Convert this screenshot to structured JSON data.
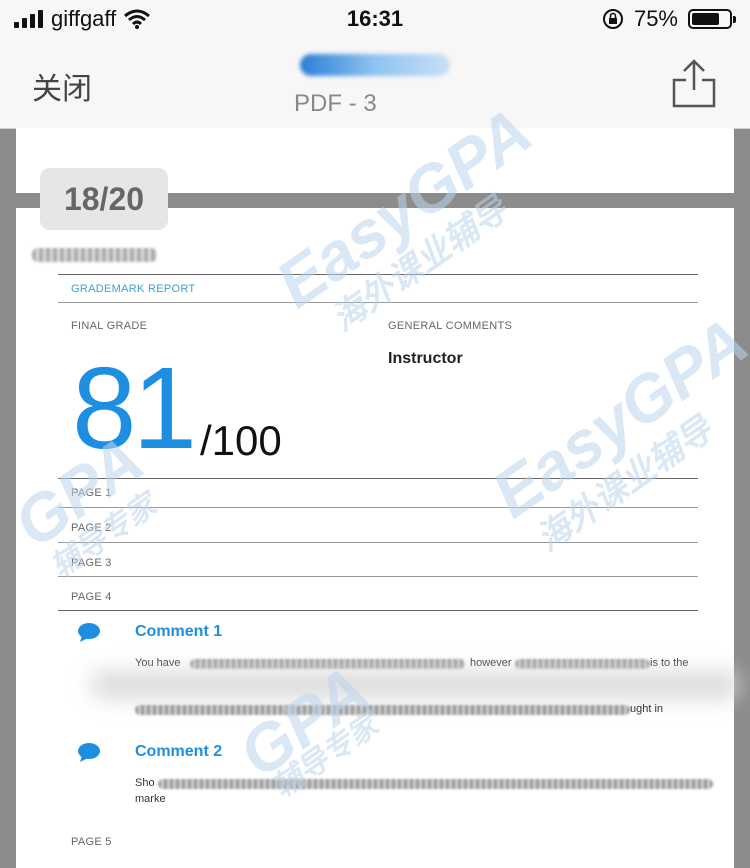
{
  "status_bar": {
    "carrier": "giffgaff",
    "time": "16:31",
    "battery_percent": "75%",
    "battery_level": 0.75
  },
  "nav": {
    "close_label": "关闭",
    "subtitle": "PDF - 3"
  },
  "page_indicator": "18/20",
  "report": {
    "header": "GRADEMARK REPORT",
    "final_grade_label": "FINAL GRADE",
    "general_comments_label": "GENERAL COMMENTS",
    "instructor_label": "Instructor",
    "grade": "81",
    "out_of": "/100",
    "pages": [
      "PAGE 1",
      "PAGE 2",
      "PAGE 3",
      "PAGE 4"
    ],
    "comments": [
      {
        "title": "Comment 1",
        "text_start": "You have",
        "text_mid": "however",
        "text_end": "is to the",
        "text_tail": "ught in"
      },
      {
        "title": "Comment 2",
        "text_start": "Sho",
        "text_line2": "marke"
      }
    ],
    "page5": "PAGE 5"
  },
  "watermark": {
    "brand": "EasyGPA",
    "brand_short": "GPA",
    "tagline1": "海外课业辅导",
    "tagline2": "辅导专家"
  },
  "colors": {
    "accent": "#1e8fe0",
    "header_blue": "#3fa0d4",
    "watermark": "#bcd6ee"
  }
}
